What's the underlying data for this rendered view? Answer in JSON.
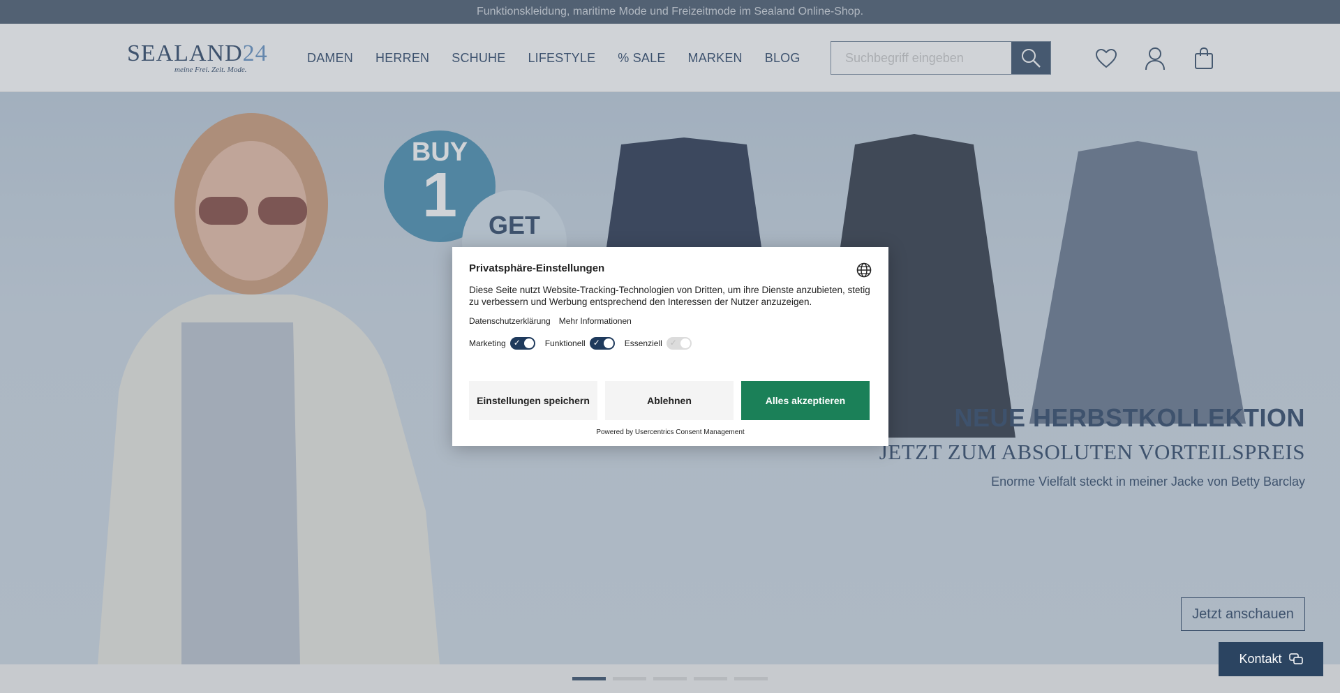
{
  "topbar": {
    "text": "Funktionskleidung, maritime Mode und Freizeitmode im Sealand Online-Shop."
  },
  "header": {
    "logo": {
      "word": "SEALAND",
      "num": "24",
      "tagline": "meine Frei. Zeit. Mode."
    },
    "nav": [
      "DAMEN",
      "HERREN",
      "SCHUHE",
      "LIFESTYLE",
      "% SALE",
      "MARKEN",
      "BLOG"
    ],
    "search_placeholder": "Suchbegriff eingeben",
    "icons": [
      "heart-icon",
      "user-icon",
      "bag-icon"
    ]
  },
  "hero": {
    "promo_badge": {
      "line1": "BUY",
      "line2": "1",
      "line3": "GET"
    },
    "headline": "NEUE HERBSTKOLLEKTION",
    "subheadline": "JETZT ZUM ABSOLUTEN VORTEILSPREIS",
    "caption": "Enorme Vielfalt steckt in meiner Jacke von Betty Barclay",
    "cta": "Jetzt anschauen",
    "slides": 5,
    "active_slide": 1
  },
  "kontakt": {
    "label": "Kontakt"
  },
  "consent": {
    "title": "Privatsphäre-Einstellungen",
    "text": "Diese Seite nutzt Website-Tracking-Technologien von Dritten, um ihre Dienste anzubieten, stetig zu verbessern und Werbung entsprechend den Interessen der Nutzer anzuzeigen.",
    "links": [
      "Datenschutzerklärung",
      "Mehr Informationen"
    ],
    "toggles": [
      {
        "label": "Marketing",
        "on": true
      },
      {
        "label": "Funktionell",
        "on": true
      },
      {
        "label": "Essenziell",
        "on": true,
        "disabled": true
      }
    ],
    "buttons": {
      "save": "Einstellungen speichern",
      "reject": "Ablehnen",
      "accept": "Alles akzeptieren"
    },
    "powered": "Powered by Usercentrics Consent Management",
    "colors": {
      "accept": "#1b8058",
      "toggle": "#1f3a5c"
    }
  }
}
